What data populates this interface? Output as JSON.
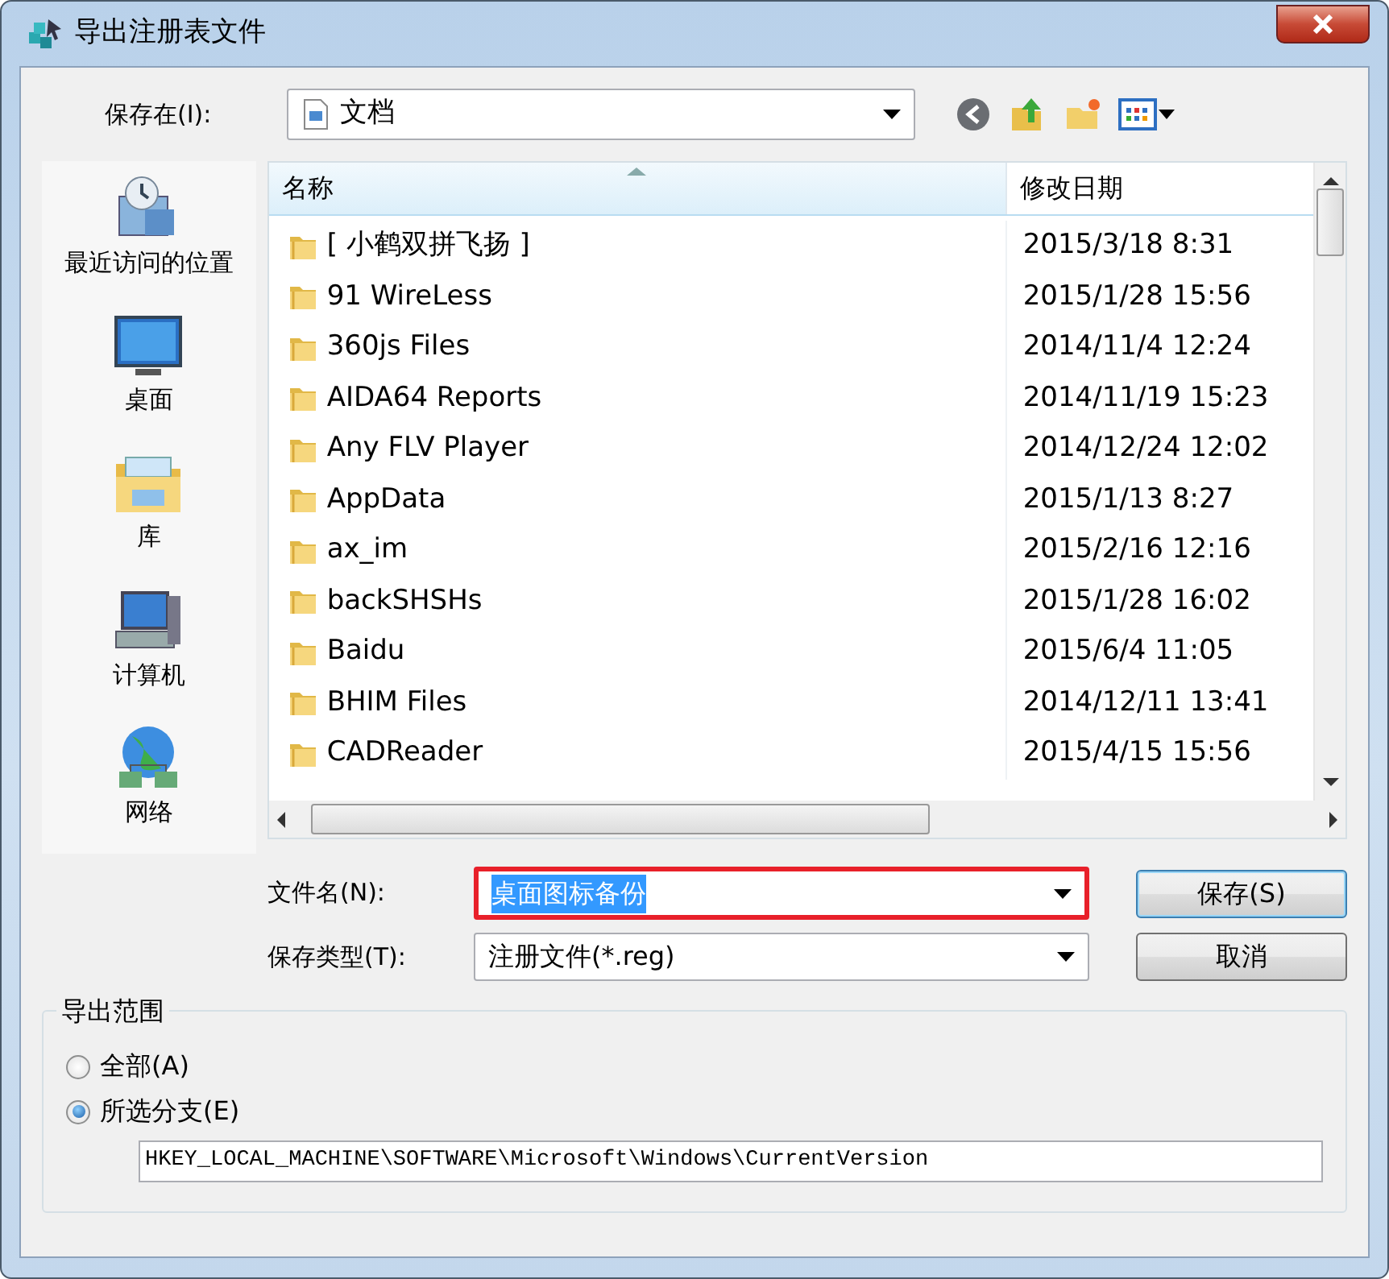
{
  "window": {
    "title": "导出注册表文件"
  },
  "save_in": {
    "label": "保存在(I):",
    "value": "文档"
  },
  "places": [
    {
      "kind": "recent",
      "label": "最近访问的位置"
    },
    {
      "kind": "desktop",
      "label": "桌面"
    },
    {
      "kind": "library",
      "label": "库"
    },
    {
      "kind": "computer",
      "label": "计算机"
    },
    {
      "kind": "network",
      "label": "网络"
    }
  ],
  "file_list": {
    "columns": [
      "名称",
      "修改日期"
    ],
    "rows": [
      {
        "name": "[ 小鹤双拼飞扬 ]",
        "modified": "2015/3/18 8:31"
      },
      {
        "name": "91 WireLess",
        "modified": "2015/1/28 15:56"
      },
      {
        "name": "360js Files",
        "modified": "2014/11/4 12:24"
      },
      {
        "name": "AIDA64 Reports",
        "modified": "2014/11/19 15:23"
      },
      {
        "name": "Any FLV Player",
        "modified": "2014/12/24 12:02"
      },
      {
        "name": "AppData",
        "modified": "2015/1/13 8:27"
      },
      {
        "name": "ax_im",
        "modified": "2015/2/16 12:16"
      },
      {
        "name": "backSHSHs",
        "modified": "2015/1/28 16:02"
      },
      {
        "name": "Baidu",
        "modified": "2015/6/4 11:05"
      },
      {
        "name": "BHIM Files",
        "modified": "2014/12/11 13:41"
      },
      {
        "name": "CADReader",
        "modified": "2015/4/15 15:56"
      }
    ]
  },
  "file_name": {
    "label": "文件名(N):",
    "value": "桌面图标备份",
    "highlighted": true
  },
  "save_type": {
    "label": "保存类型(T):",
    "value": "注册文件(*.reg)"
  },
  "buttons": [
    {
      "label": "保存(S)",
      "default": true
    },
    {
      "label": "取消",
      "default": false
    }
  ],
  "export_range": {
    "title": "导出范围",
    "options": [
      {
        "label": "全部(A)",
        "selected": false
      },
      {
        "label": "所选分支(E)",
        "selected": true
      }
    ],
    "branch_path": "HKEY_LOCAL_MACHINE\\SOFTWARE\\Microsoft\\Windows\\CurrentVersion"
  }
}
